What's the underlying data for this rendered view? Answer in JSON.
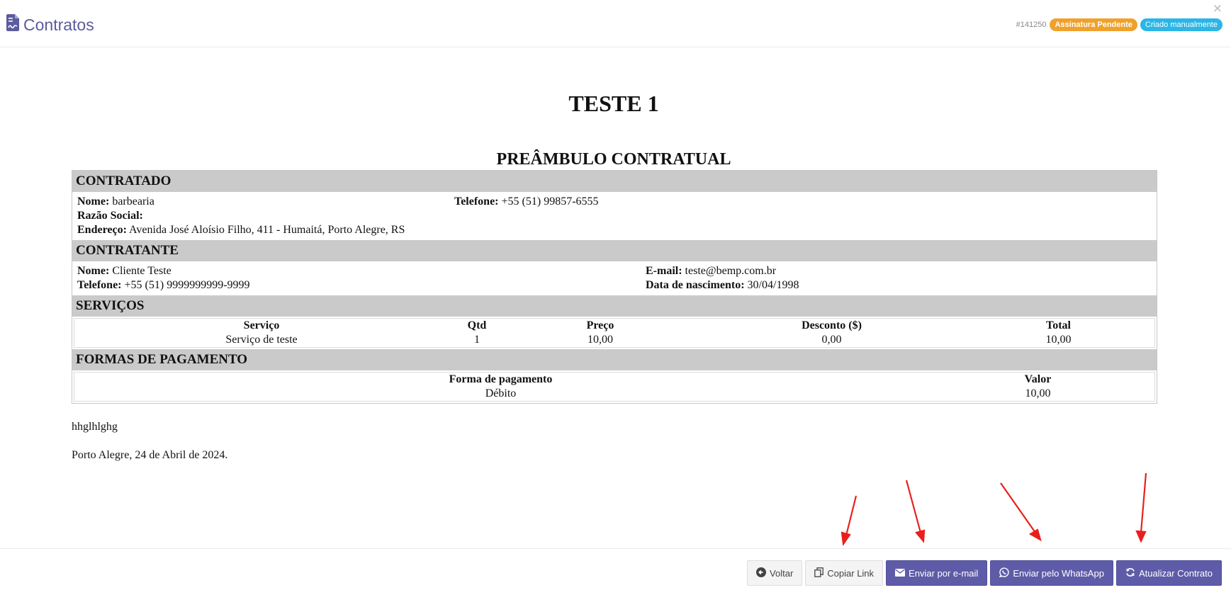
{
  "header": {
    "app_title": "Contratos",
    "contract_id": "#141250",
    "status_badge": "Assinatura Pendente",
    "origin_badge": "Criado manualmente",
    "close_label": "×"
  },
  "document": {
    "title": "TESTE 1",
    "preamble": "PREÂMBULO CONTRATUAL",
    "contratado": {
      "heading": "CONTRATADO",
      "nome_label": "Nome:",
      "nome": "barbearia",
      "telefone_label": "Telefone:",
      "telefone": "+55 (51) 99857-6555",
      "razao_label": "Razão Social:",
      "razao": "",
      "endereco_label": "Endereço:",
      "endereco": "Avenida José Aloísio Filho, 411 - Humaitá, Porto Alegre, RS"
    },
    "contratante": {
      "heading": "CONTRATANTE",
      "nome_label": "Nome:",
      "nome": "Cliente Teste",
      "email_label": "E-mail:",
      "email": "teste@bemp.com.br",
      "telefone_label": "Telefone:",
      "telefone": "+55 (51) 9999999999-9999",
      "nascimento_label": "Data de nascimento:",
      "nascimento": "30/04/1998"
    },
    "servicos": {
      "heading": "SERVIÇOS",
      "columns": [
        "Serviço",
        "Qtd",
        "Preço",
        "Desconto ($)",
        "Total"
      ],
      "rows": [
        [
          "Serviço de teste",
          "1",
          "10,00",
          "0,00",
          "10,00"
        ]
      ]
    },
    "pagamento": {
      "heading": "FORMAS DE PAGAMENTO",
      "columns": [
        "Forma de pagamento",
        "Valor"
      ],
      "rows": [
        [
          "Débito",
          "10,00"
        ]
      ]
    },
    "body_text": "hhglhlghg",
    "date_line": "Porto Alegre, 24 de Abril de 2024."
  },
  "footer": {
    "voltar": "Voltar",
    "copiar_link": "Copiar Link",
    "enviar_email": "Enviar por e-mail",
    "enviar_whatsapp": "Enviar pelo WhatsApp",
    "atualizar": "Atualizar Contrato"
  },
  "colors": {
    "primary": "#5e5ba8",
    "badge_warning": "#f0a12c",
    "badge_info": "#2bb6e5",
    "section_header": "#cacaca",
    "annotation_arrow": "#e8201c"
  },
  "icons": {
    "app": "file-contract-icon",
    "voltar": "arrow-circle-left-icon",
    "copiar": "copy-icon",
    "email": "envelope-icon",
    "whatsapp": "whatsapp-icon",
    "atualizar": "refresh-icon"
  }
}
